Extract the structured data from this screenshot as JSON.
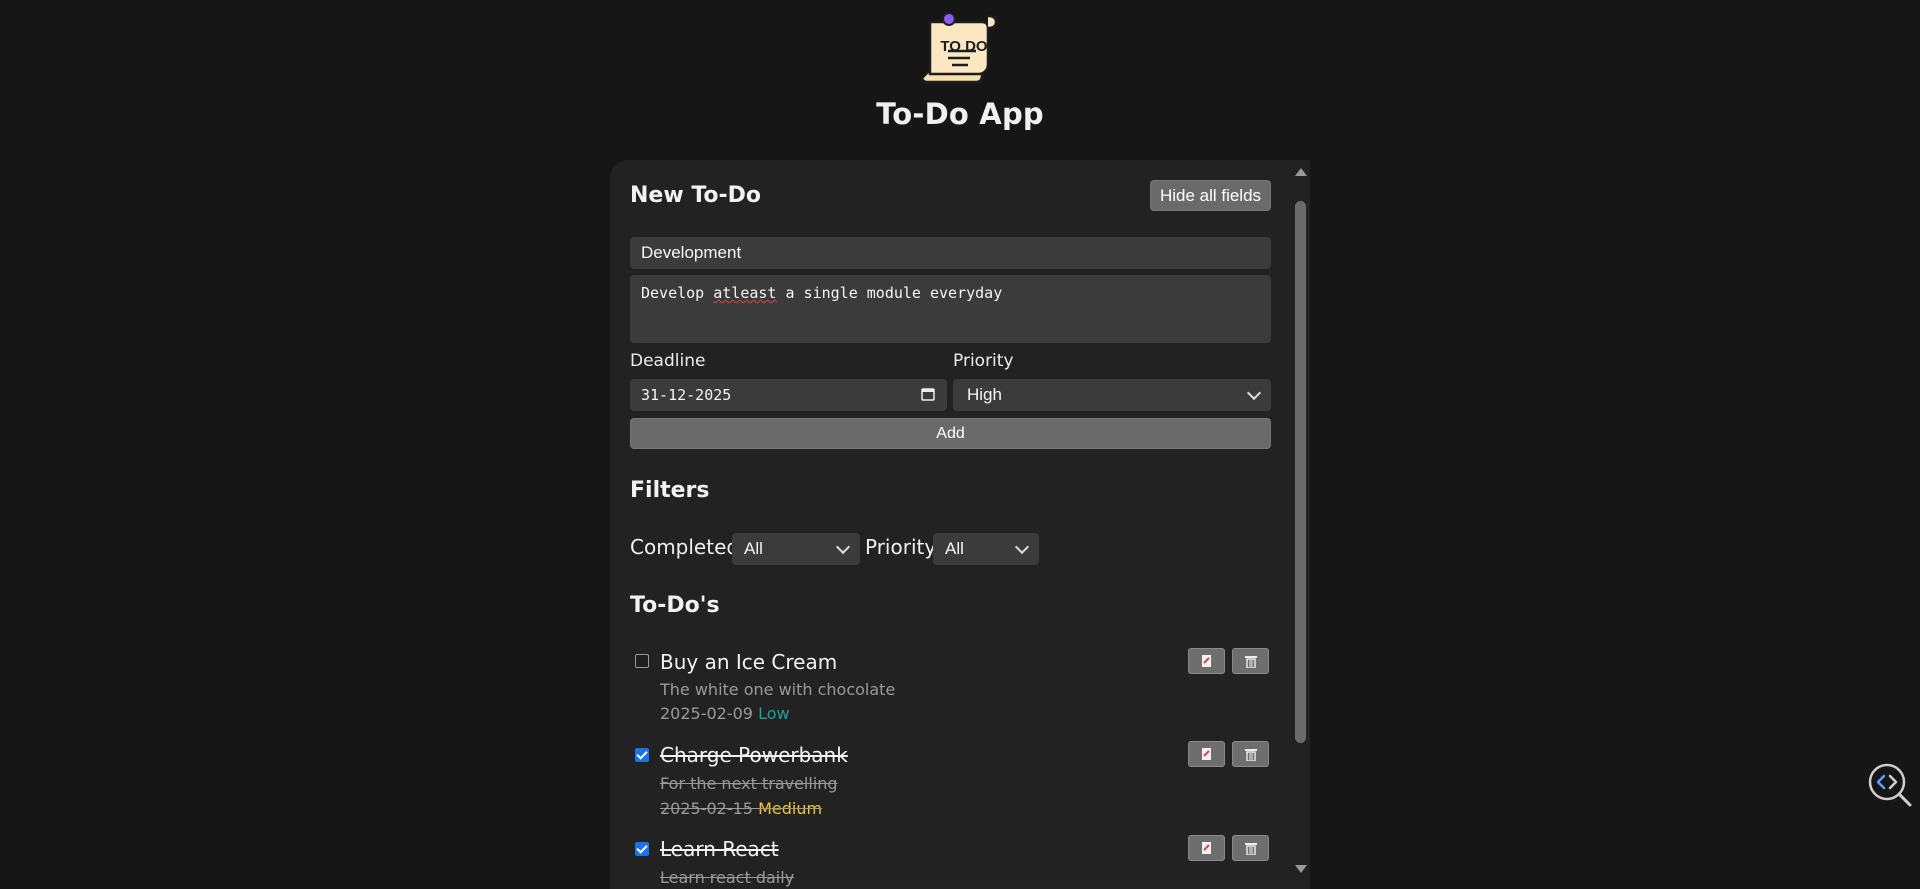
{
  "app": {
    "title": "To-Do App",
    "logo_text": "TO DO"
  },
  "new_todo": {
    "heading": "New To-Do",
    "hide_button": "Hide all fields",
    "title_value": "Development",
    "description_before": "Develop ",
    "description_misspelled": "atleast",
    "description_after": " a single module everyday",
    "deadline_label": "Deadline",
    "deadline_value": "31-12-2025",
    "priority_label": "Priority",
    "priority_value": "High",
    "add_button": "Add"
  },
  "filters": {
    "heading": "Filters",
    "completed_label": "Completed",
    "completed_value": "All",
    "priority_label": "Priority",
    "priority_value": "All"
  },
  "todos": {
    "heading": "To-Do's",
    "items": [
      {
        "title": "Buy an Ice Cream",
        "description": "The white one with chocolate",
        "date": "2025-02-09",
        "priority": "Low",
        "completed": false
      },
      {
        "title": "Charge Powerbank",
        "description": "For the next travelling",
        "date": "2025-02-15",
        "priority": "Medium",
        "completed": true
      },
      {
        "title": "Learn React",
        "description": "Learn react daily",
        "completed": true
      }
    ]
  },
  "colors": {
    "background": "#161616",
    "panel": "#222222",
    "low": "#1aa39a",
    "medium": "#f1c232",
    "checkbox": "#1a73e8"
  },
  "icons": [
    "todo-logo-icon",
    "calendar-icon",
    "chevron-down-icon",
    "edit-icon",
    "trash-icon",
    "code-search-icon"
  ]
}
